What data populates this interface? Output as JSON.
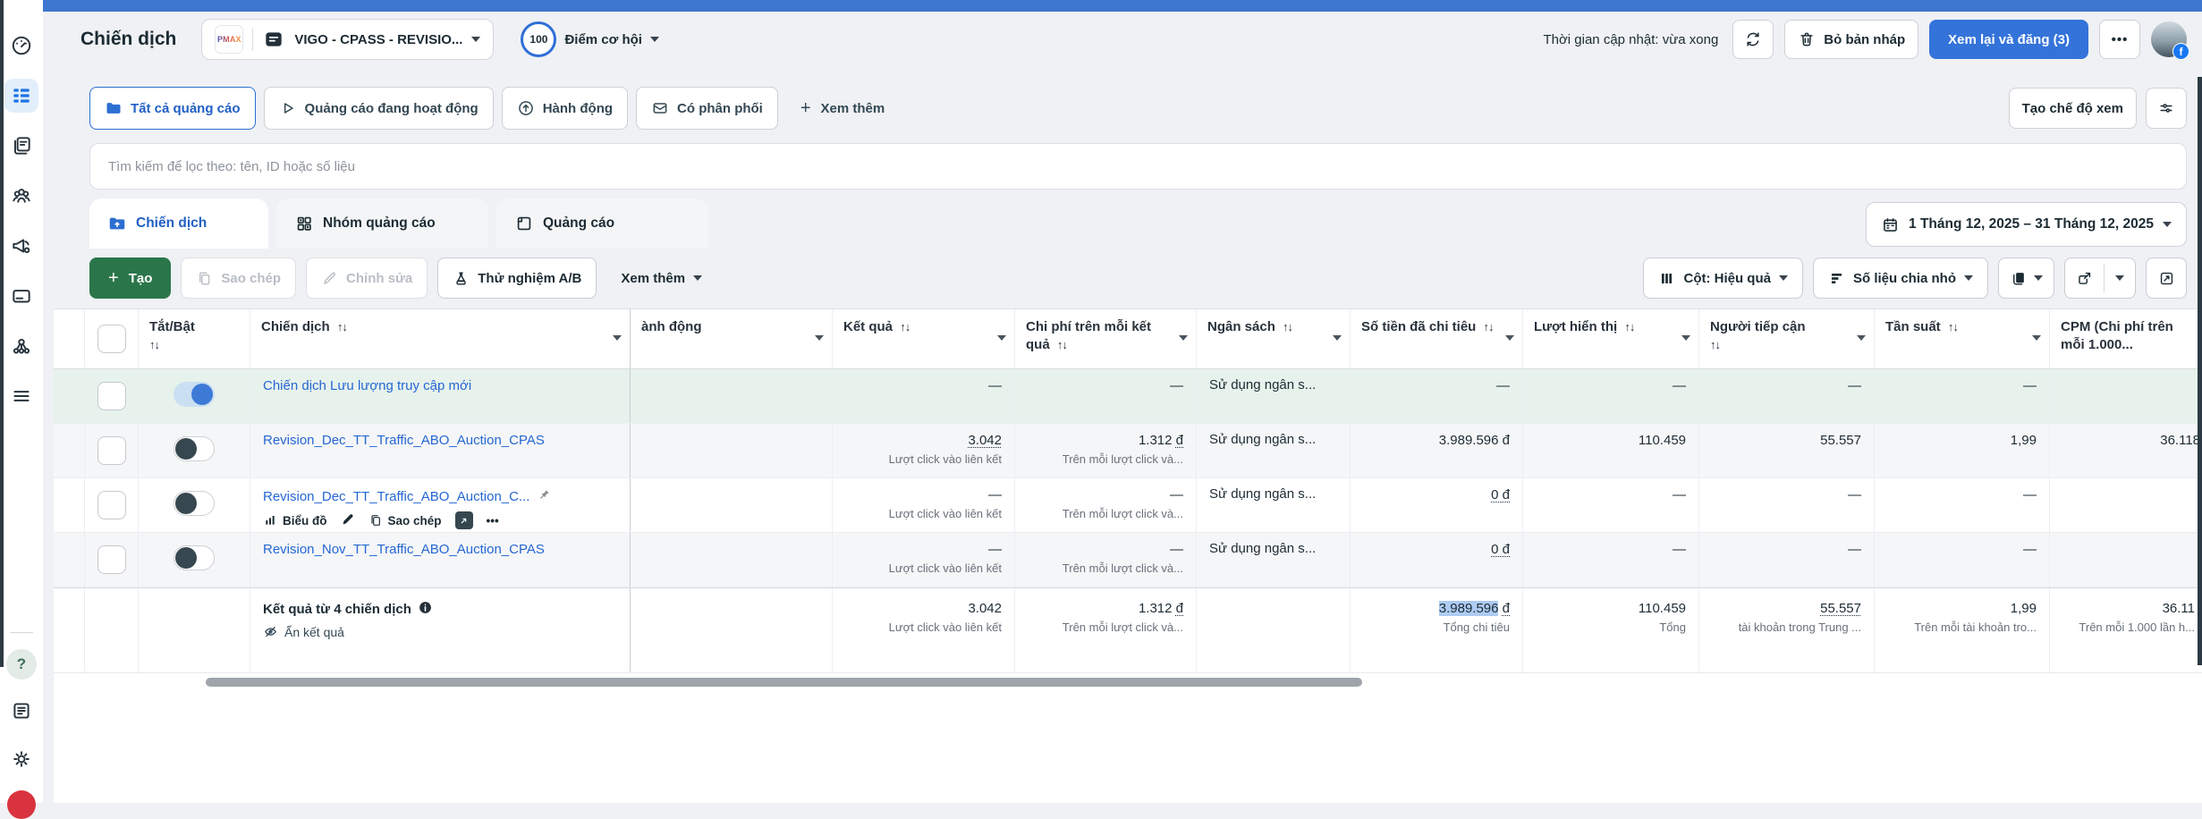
{
  "icons": {
    "sort": "↑↓",
    "dots": "•••",
    "plus": "+",
    "question": "?"
  },
  "header": {
    "title": "Chiến dịch",
    "account_logo": "PMAX",
    "account_name": "VIGO - CPASS - REVISIO...",
    "score_value": "100",
    "score_label": "Điểm cơ hội",
    "updated": "Thời gian cập nhật: vừa xong",
    "discard": "Bỏ bản nháp",
    "publish": "Xem lại và đăng (3)",
    "fb_badge": "f"
  },
  "filters": {
    "chips": [
      {
        "label": "Tất cả quảng cáo",
        "icon": "folder-icon",
        "active": true
      },
      {
        "label": "Quảng cáo đang hoạt động",
        "icon": "play-icon"
      },
      {
        "label": "Hành động",
        "icon": "arrow-up-circle-icon"
      },
      {
        "label": "Có phân phối",
        "icon": "delivery-icon"
      }
    ],
    "see_more": "Xem thêm",
    "create_view": "Tạo chế độ xem"
  },
  "search": {
    "placeholder": "Tìm kiếm để lọc theo: tên, ID hoặc số liệu"
  },
  "tabs": [
    {
      "label": "Chiến dịch",
      "active": true
    },
    {
      "label": "Nhóm quảng cáo"
    },
    {
      "label": "Quảng cáo"
    }
  ],
  "date_range": "1 Tháng 12, 2025 – 31 Tháng 12, 2025",
  "toolbar": {
    "create": "Tạo",
    "duplicate": "Sao chép",
    "edit": "Chỉnh sửa",
    "ab_test": "Thử nghiệm A/B",
    "see_more": "Xem thêm",
    "columns": "Cột: Hiệu quả",
    "breakdown": "Số liệu chia nhỏ"
  },
  "table": {
    "headers": [
      {
        "label": "Tắt/Bật",
        "sort": "↑↓"
      },
      {
        "label": "Chiến dịch",
        "sort": "↑↓"
      },
      {
        "label": "ành động",
        "sort": ""
      },
      {
        "label": "Kết quả",
        "sort": "↑↓"
      },
      {
        "label": "Chi phí trên mỗi kết quả",
        "sort": "↑↓"
      },
      {
        "label": "Ngân sách",
        "sort": "↑↓"
      },
      {
        "label": "Số tiền đã chi tiêu",
        "sort": "↑↓"
      },
      {
        "label": "Lượt hiển thị",
        "sort": "↑↓"
      },
      {
        "label": "Người tiếp cận",
        "sort": "↑↓"
      },
      {
        "label": "Tần suất",
        "sort": "↑↓"
      },
      {
        "label": "CPM (Chi phí trên mỗi 1.000...",
        "sort": ""
      }
    ],
    "rows": [
      {
        "name": "Chiến dịch Lưu lượng truy cập mới",
        "toggle": "on",
        "results": "—",
        "results_sub": "",
        "cpr": "—",
        "cpr_cur": "",
        "cpr_sub": "",
        "budget": "Sử dụng ngân s...",
        "spent": "—",
        "impressions": "—",
        "reach": "—",
        "frequency": "—",
        "cpm": ""
      },
      {
        "name": "Revision_Dec_TT_Traffic_ABO_Auction_CPAS",
        "toggle": "off",
        "results": "3.042",
        "results_sub": "Lượt click vào liên kết",
        "cpr": "1.312",
        "cpr_cur": "đ",
        "cpr_sub": "Trên mỗi lượt click và...",
        "budget": "Sử dụng ngân s...",
        "spent": "3.989.596 đ",
        "impressions": "110.459",
        "reach": "55.557",
        "frequency": "1,99",
        "cpm": "36.118"
      },
      {
        "name": "Revision_Dec_TT_Traffic_ABO_Auction_C...",
        "toggle": "off",
        "pinned": true,
        "actions": {
          "chart": "Biểu đồ",
          "duplicate": "Sao chép",
          "more": "•••"
        },
        "results": "—",
        "results_sub": "Lượt click vào liên kết",
        "cpr": "—",
        "cpr_cur": "",
        "cpr_sub": "Trên mỗi lượt click và...",
        "budget": "Sử dụng ngân s...",
        "spent": "0 đ",
        "impressions": "—",
        "reach": "—",
        "frequency": "—",
        "cpm": ""
      },
      {
        "name": "Revision_Nov_TT_Traffic_ABO_Auction_CPAS",
        "toggle": "off",
        "results": "—",
        "results_sub": "Lượt click vào liên kết",
        "cpr": "—",
        "cpr_cur": "",
        "cpr_sub": "Trên mỗi lượt click và...",
        "budget": "Sử dụng ngân s...",
        "spent": "0 đ",
        "impressions": "—",
        "reach": "—",
        "frequency": "—",
        "cpm": ""
      }
    ],
    "summary": {
      "title": "Kết quả từ 4 chiến dịch",
      "hide_results": "Ẩn kết quả",
      "results": "3.042",
      "results_sub": "Lượt click vào liên kết",
      "cpr": "1.312",
      "cpr_cur": "đ",
      "cpr_sub": "Trên mỗi lượt click và...",
      "spent_num": "3.989.596",
      "spent_cur": "đ",
      "spent_sub": "Tổng chi tiêu",
      "impressions": "110.459",
      "impressions_sub": "Tổng",
      "reach": "55.557",
      "reach_sub": "tài khoản trong Trung ...",
      "frequency": "1,99",
      "frequency_sub": "Trên mỗi tài khoản tro...",
      "cpm": "36.11",
      "cpm_sub": "Trên mỗi 1.000 lần h..."
    }
  }
}
